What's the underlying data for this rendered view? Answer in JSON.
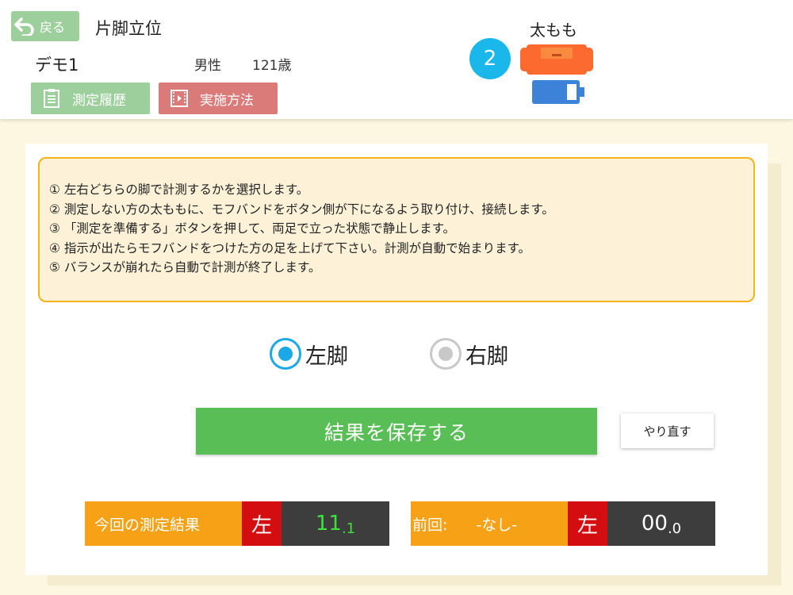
{
  "header": {
    "back_label": "戻る",
    "page_title": "片脚立位",
    "user_name": "デモ1",
    "user_gender": "男性",
    "user_age": "121歳",
    "history_label": "測定履歴",
    "method_label": "実施方法",
    "sensor_label": "太もも",
    "sensor_number": "2"
  },
  "instructions": [
    "① 左右どちらの脚で計測するかを選択します。",
    "② 測定しない方の太ももに、モフバンドをボタン側が下になるよう取り付け、接続します。",
    "③ 「測定を準備する」ボタンを押して、両足で立った状態で静止します。",
    "④ 指示が出たらモフバンドをつけた方の足を上げて下さい。計測が自動で始まります。",
    "⑤ バランスが崩れたら自動で計測が終了します。"
  ],
  "leg_select": {
    "left_label": "左脚",
    "right_label": "右脚",
    "selected": "left"
  },
  "actions": {
    "save_label": "結果を保存する",
    "redo_label": "やり直す"
  },
  "current_result": {
    "label": "今回の測定結果",
    "side": "左",
    "value_main": "11",
    "value_decimal": ".1"
  },
  "previous_result": {
    "label": "前回:",
    "status": "-なし-",
    "side": "左",
    "value_main": "00",
    "value_decimal": ".0"
  },
  "colors": {
    "green": "#9ccf9b",
    "red": "#db7b79",
    "accent_blue": "#1ab7ea",
    "save_green": "#58be55",
    "orange": "#f7a216",
    "side_red": "#d40e10"
  }
}
